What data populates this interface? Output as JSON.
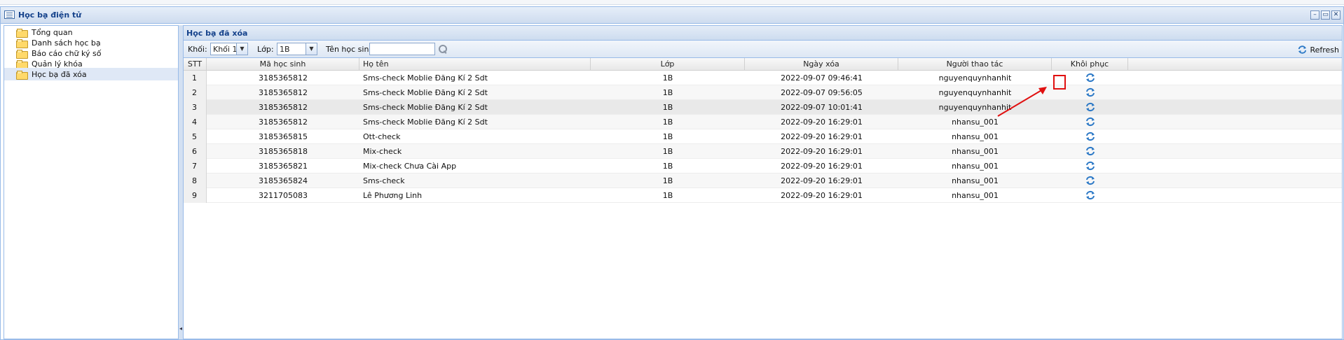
{
  "window": {
    "title": "Học bạ điện tử",
    "controls": [
      "–",
      "▭",
      "✕"
    ]
  },
  "sidebar": {
    "items": [
      {
        "label": "Tổng quan"
      },
      {
        "label": "Danh sách học bạ"
      },
      {
        "label": "Báo cáo chữ ký số"
      },
      {
        "label": "Quản lý khóa"
      },
      {
        "label": "Học bạ đã xóa"
      }
    ],
    "selected_index": 4
  },
  "panel": {
    "title": "Học bạ đã xóa"
  },
  "toolbar": {
    "khoi_label": "Khối:",
    "khoi_value": "Khối 1",
    "lop_label": "Lớp:",
    "lop_value": "1B",
    "ten_label": "Tên học sinh:",
    "ten_value": "",
    "refresh_label": "Refresh"
  },
  "grid": {
    "columns": [
      "STT",
      "Mã học sinh",
      "Họ tên",
      "Lớp",
      "Ngày xóa",
      "Người thao tác",
      "Khôi phục"
    ],
    "rows": [
      {
        "stt": "1",
        "ma": "3185365812",
        "ten": "Sms-check Moblie Đăng Kí 2 Sdt",
        "lop": "1B",
        "ngay": "2022-09-07 09:46:41",
        "nguoi": "nguyenquynhanhit"
      },
      {
        "stt": "2",
        "ma": "3185365812",
        "ten": "Sms-check Moblie Đăng Kí 2 Sdt",
        "lop": "1B",
        "ngay": "2022-09-07 09:56:05",
        "nguoi": "nguyenquynhanhit"
      },
      {
        "stt": "3",
        "ma": "3185365812",
        "ten": "Sms-check Moblie Đăng Kí 2 Sdt",
        "lop": "1B",
        "ngay": "2022-09-07 10:01:41",
        "nguoi": "nguyenquynhanhit"
      },
      {
        "stt": "4",
        "ma": "3185365812",
        "ten": "Sms-check Moblie Đăng Kí 2 Sdt",
        "lop": "1B",
        "ngay": "2022-09-20 16:29:01",
        "nguoi": "nhansu_001"
      },
      {
        "stt": "5",
        "ma": "3185365815",
        "ten": "Ott-check",
        "lop": "1B",
        "ngay": "2022-09-20 16:29:01",
        "nguoi": "nhansu_001"
      },
      {
        "stt": "6",
        "ma": "3185365818",
        "ten": "Mix-check",
        "lop": "1B",
        "ngay": "2022-09-20 16:29:01",
        "nguoi": "nhansu_001"
      },
      {
        "stt": "7",
        "ma": "3185365821",
        "ten": "Mix-check Chưa Cài App",
        "lop": "1B",
        "ngay": "2022-09-20 16:29:01",
        "nguoi": "nhansu_001"
      },
      {
        "stt": "8",
        "ma": "3185365824",
        "ten": "Sms-check",
        "lop": "1B",
        "ngay": "2022-09-20 16:29:01",
        "nguoi": "nhansu_001"
      },
      {
        "stt": "9",
        "ma": "3211705083",
        "ten": "Lê Phương Linh",
        "lop": "1B",
        "ngay": "2022-09-20 16:29:01",
        "nguoi": "nhansu_001"
      }
    ]
  },
  "colors": {
    "border": "#99bbe8",
    "title_text": "#15428b",
    "highlight": "#e01010"
  }
}
